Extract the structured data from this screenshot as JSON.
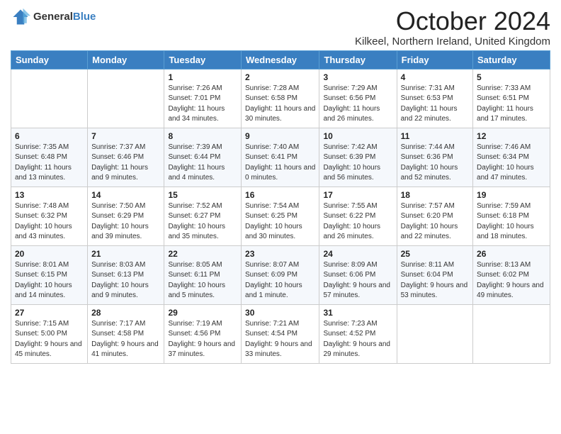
{
  "header": {
    "logo_general": "General",
    "logo_blue": "Blue",
    "month_title": "October 2024",
    "subtitle": "Kilkeel, Northern Ireland, United Kingdom"
  },
  "days_of_week": [
    "Sunday",
    "Monday",
    "Tuesday",
    "Wednesday",
    "Thursday",
    "Friday",
    "Saturday"
  ],
  "weeks": [
    [
      {
        "day": "",
        "info": ""
      },
      {
        "day": "",
        "info": ""
      },
      {
        "day": "1",
        "info": "Sunrise: 7:26 AM\nSunset: 7:01 PM\nDaylight: 11 hours and 34 minutes."
      },
      {
        "day": "2",
        "info": "Sunrise: 7:28 AM\nSunset: 6:58 PM\nDaylight: 11 hours and 30 minutes."
      },
      {
        "day": "3",
        "info": "Sunrise: 7:29 AM\nSunset: 6:56 PM\nDaylight: 11 hours and 26 minutes."
      },
      {
        "day": "4",
        "info": "Sunrise: 7:31 AM\nSunset: 6:53 PM\nDaylight: 11 hours and 22 minutes."
      },
      {
        "day": "5",
        "info": "Sunrise: 7:33 AM\nSunset: 6:51 PM\nDaylight: 11 hours and 17 minutes."
      }
    ],
    [
      {
        "day": "6",
        "info": "Sunrise: 7:35 AM\nSunset: 6:48 PM\nDaylight: 11 hours and 13 minutes."
      },
      {
        "day": "7",
        "info": "Sunrise: 7:37 AM\nSunset: 6:46 PM\nDaylight: 11 hours and 9 minutes."
      },
      {
        "day": "8",
        "info": "Sunrise: 7:39 AM\nSunset: 6:44 PM\nDaylight: 11 hours and 4 minutes."
      },
      {
        "day": "9",
        "info": "Sunrise: 7:40 AM\nSunset: 6:41 PM\nDaylight: 11 hours and 0 minutes."
      },
      {
        "day": "10",
        "info": "Sunrise: 7:42 AM\nSunset: 6:39 PM\nDaylight: 10 hours and 56 minutes."
      },
      {
        "day": "11",
        "info": "Sunrise: 7:44 AM\nSunset: 6:36 PM\nDaylight: 10 hours and 52 minutes."
      },
      {
        "day": "12",
        "info": "Sunrise: 7:46 AM\nSunset: 6:34 PM\nDaylight: 10 hours and 47 minutes."
      }
    ],
    [
      {
        "day": "13",
        "info": "Sunrise: 7:48 AM\nSunset: 6:32 PM\nDaylight: 10 hours and 43 minutes."
      },
      {
        "day": "14",
        "info": "Sunrise: 7:50 AM\nSunset: 6:29 PM\nDaylight: 10 hours and 39 minutes."
      },
      {
        "day": "15",
        "info": "Sunrise: 7:52 AM\nSunset: 6:27 PM\nDaylight: 10 hours and 35 minutes."
      },
      {
        "day": "16",
        "info": "Sunrise: 7:54 AM\nSunset: 6:25 PM\nDaylight: 10 hours and 30 minutes."
      },
      {
        "day": "17",
        "info": "Sunrise: 7:55 AM\nSunset: 6:22 PM\nDaylight: 10 hours and 26 minutes."
      },
      {
        "day": "18",
        "info": "Sunrise: 7:57 AM\nSunset: 6:20 PM\nDaylight: 10 hours and 22 minutes."
      },
      {
        "day": "19",
        "info": "Sunrise: 7:59 AM\nSunset: 6:18 PM\nDaylight: 10 hours and 18 minutes."
      }
    ],
    [
      {
        "day": "20",
        "info": "Sunrise: 8:01 AM\nSunset: 6:15 PM\nDaylight: 10 hours and 14 minutes."
      },
      {
        "day": "21",
        "info": "Sunrise: 8:03 AM\nSunset: 6:13 PM\nDaylight: 10 hours and 9 minutes."
      },
      {
        "day": "22",
        "info": "Sunrise: 8:05 AM\nSunset: 6:11 PM\nDaylight: 10 hours and 5 minutes."
      },
      {
        "day": "23",
        "info": "Sunrise: 8:07 AM\nSunset: 6:09 PM\nDaylight: 10 hours and 1 minute."
      },
      {
        "day": "24",
        "info": "Sunrise: 8:09 AM\nSunset: 6:06 PM\nDaylight: 9 hours and 57 minutes."
      },
      {
        "day": "25",
        "info": "Sunrise: 8:11 AM\nSunset: 6:04 PM\nDaylight: 9 hours and 53 minutes."
      },
      {
        "day": "26",
        "info": "Sunrise: 8:13 AM\nSunset: 6:02 PM\nDaylight: 9 hours and 49 minutes."
      }
    ],
    [
      {
        "day": "27",
        "info": "Sunrise: 7:15 AM\nSunset: 5:00 PM\nDaylight: 9 hours and 45 minutes."
      },
      {
        "day": "28",
        "info": "Sunrise: 7:17 AM\nSunset: 4:58 PM\nDaylight: 9 hours and 41 minutes."
      },
      {
        "day": "29",
        "info": "Sunrise: 7:19 AM\nSunset: 4:56 PM\nDaylight: 9 hours and 37 minutes."
      },
      {
        "day": "30",
        "info": "Sunrise: 7:21 AM\nSunset: 4:54 PM\nDaylight: 9 hours and 33 minutes."
      },
      {
        "day": "31",
        "info": "Sunrise: 7:23 AM\nSunset: 4:52 PM\nDaylight: 9 hours and 29 minutes."
      },
      {
        "day": "",
        "info": ""
      },
      {
        "day": "",
        "info": ""
      }
    ]
  ]
}
